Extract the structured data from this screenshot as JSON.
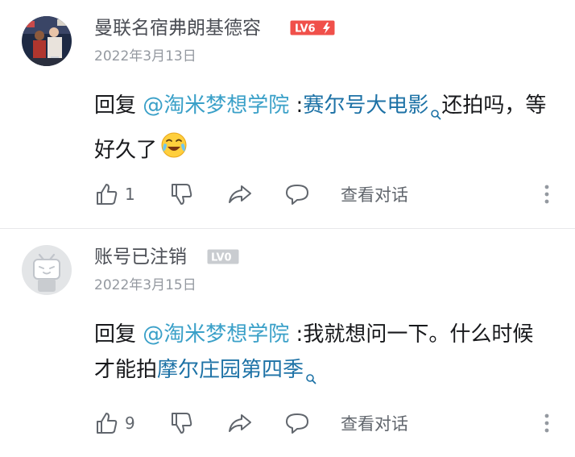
{
  "comments": [
    {
      "username": "曼联名宿弗朗基德容",
      "level": "LV6",
      "date": "2022年3月13日",
      "reply_prefix": "回复 ",
      "mention": "@淘米梦想学院",
      "colon": " :",
      "topic": "赛尔号大电影",
      "text_after": "还拍吗，等好久了",
      "emoji": "crying-laughing",
      "likes": "1",
      "view_conversation": "查看对话",
      "level_color": "#f0504a"
    },
    {
      "username": "账号已注销",
      "level": "LV0",
      "date": "2022年3月15日",
      "reply_prefix": "回复 ",
      "mention": "@淘米梦想学院",
      "colon": " :",
      "text_before": "我就想问一下。什么时候才能拍",
      "topic": "摩尔庄园第四季",
      "likes": "9",
      "view_conversation": "查看对话",
      "level_color": "#c9ccd0"
    }
  ]
}
